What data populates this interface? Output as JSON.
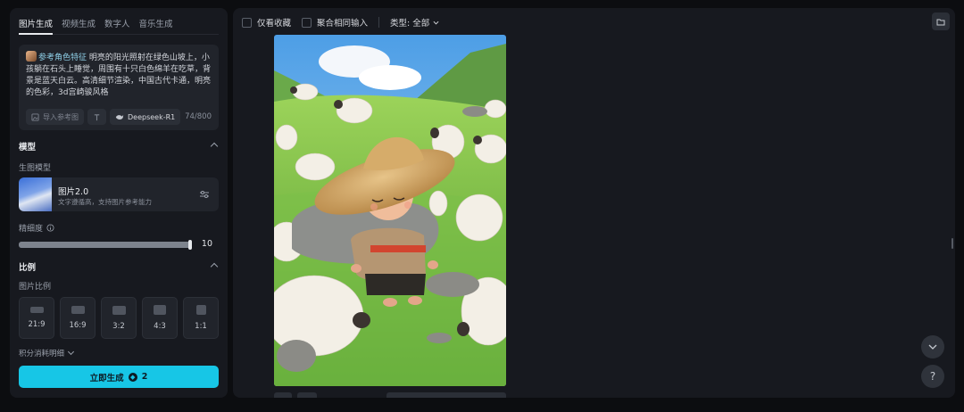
{
  "tabs": [
    "图片生成",
    "视频生成",
    "数字人",
    "音乐生成"
  ],
  "prompt": {
    "ref_tag": "参考角色特征",
    "text": "明亮的阳光照射在绿色山坡上，小孩躺在石头上睡觉，周围有十只白色绵羊在吃草，背景是蓝天白云。高清细节渲染，中国古代卡通，明亮的色彩，3d宫崎骏风格",
    "import_ref_label": "导入参考图",
    "model_label": "Deepseek-R1",
    "counter": "74/800"
  },
  "model_section": {
    "title": "模型",
    "sub_label": "生图模型",
    "model_name": "图片2.0",
    "model_desc": "文字遵循高，支持图片参考能力"
  },
  "precision": {
    "label": "精细度",
    "value_text": "10",
    "level": 1.0
  },
  "ratio_section": {
    "title": "比例",
    "sub_label": "图片比例",
    "ratios": [
      "21:9",
      "16:9",
      "3:2",
      "4:3",
      "1:1"
    ]
  },
  "credits_label": "积分消耗明细",
  "generate": {
    "label": "立即生成",
    "cost": "2"
  },
  "toolbar": {
    "only_favorites": "仅看收藏",
    "merge_inputs": "聚合相同输入",
    "type_filter": "类型: 全部"
  },
  "colors": {
    "accent": "#17c6e6",
    "panel": "#17191f",
    "background": "#0c0d10"
  },
  "icons": [
    "folder-icon",
    "chevron-down-icon",
    "help-icon",
    "settings-sliders-icon",
    "image-icon",
    "text-icon",
    "whale-icon",
    "info-icon"
  ]
}
